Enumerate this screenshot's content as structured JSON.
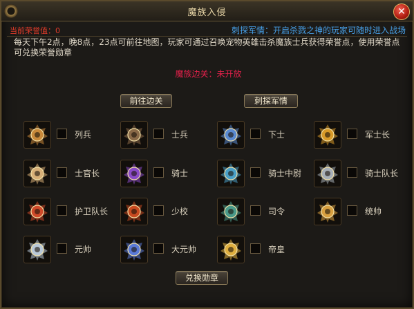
{
  "window": {
    "title": "魔族入侵",
    "close_symbol": "✕"
  },
  "honor": {
    "label": "当前荣誉值：",
    "value": "0"
  },
  "scout_notice": "刺探军情：开启杀戮之神的玩家可随时进入战场",
  "description": "每天下午2点，晚8点，23点可前往地图，玩家可通过召唤宠物英雄击杀魔族士兵获得荣誉点，使用荣誉点可兑换荣誉勋章",
  "border_status": "魔族边关：未开放",
  "buttons": {
    "goto_border": "前往边关",
    "scout": "刺探军情",
    "exchange": "兑换勋章"
  },
  "ranks": [
    {
      "label": "列兵",
      "icon": "private-medal-icon",
      "color": "#c9893a"
    },
    {
      "label": "士兵",
      "icon": "soldier-medal-icon",
      "color": "#8a6a48"
    },
    {
      "label": "下士",
      "icon": "corporal-medal-icon",
      "color": "#5a8ad0"
    },
    {
      "label": "军士长",
      "icon": "sergeant-major-medal-icon",
      "color": "#d89a28"
    },
    {
      "label": "士官长",
      "icon": "chief-nco-medal-icon",
      "color": "#d8b078"
    },
    {
      "label": "骑士",
      "icon": "knight-medal-icon",
      "color": "#8a4ac8"
    },
    {
      "label": "骑士中尉",
      "icon": "knight-lieutenant-medal-icon",
      "color": "#4aa0c8"
    },
    {
      "label": "骑士队长",
      "icon": "knight-captain-medal-icon",
      "color": "#a8b0b8"
    },
    {
      "label": "护卫队长",
      "icon": "guard-captain-medal-icon",
      "color": "#d04a2a"
    },
    {
      "label": "少校",
      "icon": "major-medal-icon",
      "color": "#c84a20"
    },
    {
      "label": "司令",
      "icon": "commander-medal-icon",
      "color": "#4a9a8a"
    },
    {
      "label": "统帅",
      "icon": "marshal-medal-icon",
      "color": "#d8a040"
    },
    {
      "label": "元帅",
      "icon": "field-marshal-medal-icon",
      "color": "#b8c8d8"
    },
    {
      "label": "大元帅",
      "icon": "grand-marshal-medal-icon",
      "color": "#5a7ad8"
    },
    {
      "label": "帝皇",
      "icon": "emperor-medal-icon",
      "color": "#e0b040"
    }
  ]
}
